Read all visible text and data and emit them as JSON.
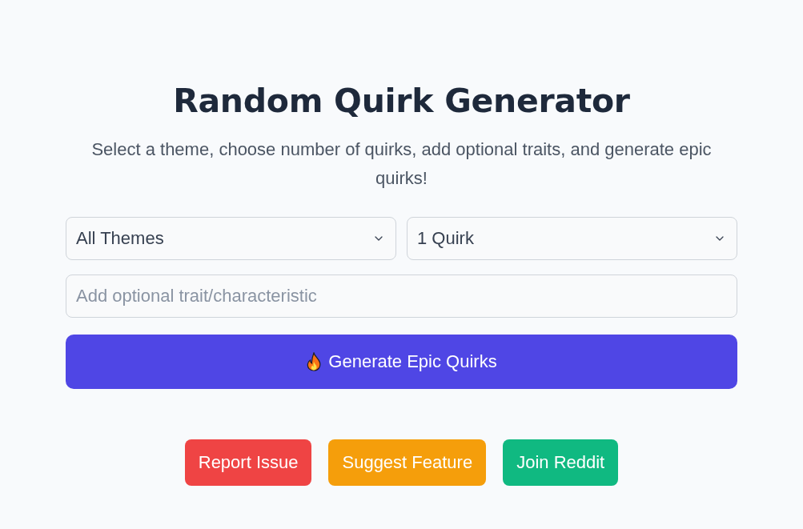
{
  "title": "Random Quirk Generator",
  "subtitle": "Select a theme, choose number of quirks, add optional traits, and generate epic quirks!",
  "controls": {
    "theme_select": {
      "value": "All Themes"
    },
    "count_select": {
      "value": "1 Quirk"
    },
    "trait_field": {
      "placeholder": "Add optional trait/characteristic"
    },
    "generate_button": {
      "label": "Generate Epic Quirks"
    }
  },
  "links": [
    {
      "label": "Report Issue",
      "color": "#ef4444"
    },
    {
      "label": "Suggest Feature",
      "color": "#f59e0b"
    },
    {
      "label": "Join Reddit",
      "color": "#10b981"
    }
  ]
}
